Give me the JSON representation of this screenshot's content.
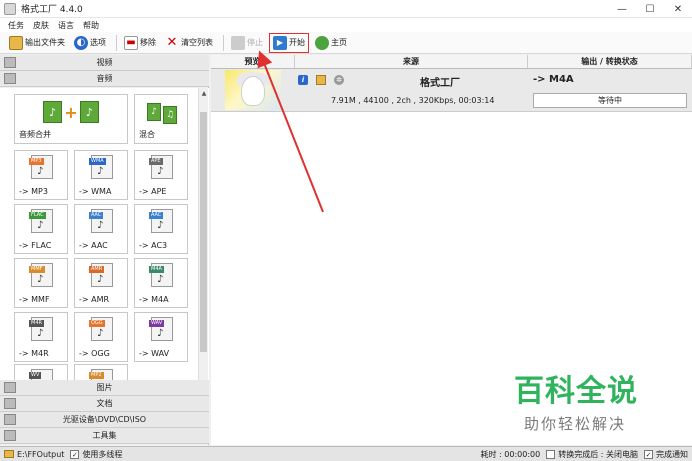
{
  "window": {
    "title": "格式工厂 4.4.0",
    "controls": [
      "—",
      "☐",
      "✕"
    ]
  },
  "menu": [
    "任务",
    "皮肤",
    "语言",
    "帮助"
  ],
  "toolbar": {
    "output_folder": "输出文件夹",
    "options": "选项",
    "remove": "移除",
    "clear_list": "清空列表",
    "stop": "停止",
    "start": "开始",
    "home": "主页"
  },
  "categories": {
    "video": "视频",
    "audio": "音频",
    "image": "图片",
    "document": "文档",
    "optical": "光驱设备\\DVD\\CD\\ISO",
    "tools": "工具集"
  },
  "tiles": {
    "merge": "音频合并",
    "mix": "混合",
    "formats": [
      {
        "band": "MP3",
        "label": "-> MP3",
        "color": "#e6742d"
      },
      {
        "band": "WMA",
        "label": "-> WMA",
        "color": "#2a67c9"
      },
      {
        "band": "APE",
        "label": "-> APE",
        "color": "#6a6a6a"
      },
      {
        "band": "FLAC",
        "label": "-> FLAC",
        "color": "#3a9a3a"
      },
      {
        "band": "AAC",
        "label": "-> AAC",
        "color": "#3a7fd0"
      },
      {
        "band": "AAC",
        "label": "-> AC3",
        "color": "#3a7fd0"
      },
      {
        "band": "MMF",
        "label": "-> MMF",
        "color": "#d88b2a"
      },
      {
        "band": "AMR",
        "label": "-> AMR",
        "color": "#d86a2a"
      },
      {
        "band": "M4A",
        "label": "-> M4A",
        "color": "#3a8a6a"
      },
      {
        "band": "M4R",
        "label": "-> M4R",
        "color": "#555555"
      },
      {
        "band": "OGG",
        "label": "-> OGG",
        "color": "#e6742d"
      },
      {
        "band": "WAV",
        "label": "-> WAV",
        "color": "#7a3aa0"
      }
    ]
  },
  "table": {
    "headers": [
      "预览",
      "来源",
      "输出 / 转换状态"
    ],
    "row": {
      "source_name": "格式工厂",
      "meta": "7.91M , 44100 , 2ch , 320Kbps, 00:03:14",
      "target": "-> M4A",
      "status": "等待中"
    }
  },
  "watermark": {
    "main": "百科全说",
    "sub": "助你轻松解决"
  },
  "statusbar": {
    "output_path": "E:\\FFOutput",
    "multithread": "使用多线程",
    "elapsed": "耗时 : 00:00:00",
    "after_convert": "转换完成后 : 关闭电脑",
    "notify": "完成通知"
  },
  "colors": {
    "highlight": "#e03030",
    "arrow": "#e03030",
    "watermark": "#2fb35c"
  }
}
